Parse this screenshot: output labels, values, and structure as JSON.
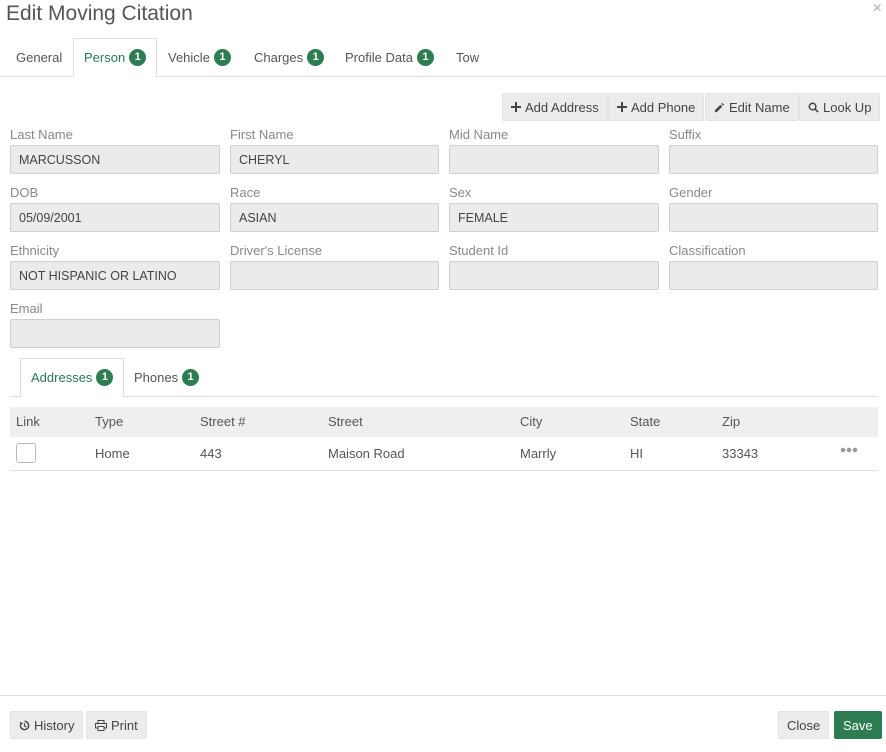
{
  "dialog": {
    "title": "Edit Moving Citation",
    "close_symbol": "×"
  },
  "tabs": [
    {
      "label": "General",
      "badge": ""
    },
    {
      "label": "Person",
      "badge": "1",
      "active": true
    },
    {
      "label": "Vehicle",
      "badge": "1"
    },
    {
      "label": "Charges",
      "badge": "1"
    },
    {
      "label": "Profile Data",
      "badge": "1"
    },
    {
      "label": "Tow",
      "badge": ""
    }
  ],
  "toolbar": {
    "add_address": "Add Address",
    "add_phone": "Add Phone",
    "edit_name": "Edit Name",
    "look_up": "Look Up"
  },
  "fields": {
    "last_name": {
      "label": "Last Name",
      "value": "MARCUSSON"
    },
    "first_name": {
      "label": "First Name",
      "value": "CHERYL"
    },
    "mid_name": {
      "label": "Mid Name",
      "value": ""
    },
    "suffix": {
      "label": "Suffix",
      "value": ""
    },
    "dob": {
      "label": "DOB",
      "value": "05/09/2001"
    },
    "race": {
      "label": "Race",
      "value": "ASIAN"
    },
    "sex": {
      "label": "Sex",
      "value": "FEMALE"
    },
    "gender": {
      "label": "Gender",
      "value": ""
    },
    "ethnicity": {
      "label": "Ethnicity",
      "value": "NOT HISPANIC OR LATINO"
    },
    "drivers_license": {
      "label": "Driver's License",
      "value": ""
    },
    "student_id": {
      "label": "Student Id",
      "value": ""
    },
    "classification": {
      "label": "Classification",
      "value": ""
    },
    "email": {
      "label": "Email",
      "value": ""
    }
  },
  "subtabs": [
    {
      "label": "Addresses",
      "badge": "1",
      "active": true
    },
    {
      "label": "Phones",
      "badge": "1"
    }
  ],
  "address_table": {
    "columns": [
      "Link",
      "Type",
      "Street #",
      "Street",
      "City",
      "State",
      "Zip"
    ],
    "rows": [
      {
        "type": "Home",
        "street_no": "443",
        "street": "Maison Road",
        "city": "Marrly",
        "state": "HI",
        "zip": "33343"
      }
    ]
  },
  "footer": {
    "history": "History",
    "print": "Print",
    "close": "Close",
    "save": "Save"
  },
  "colors": {
    "accent": "#2e7d52",
    "input_bg": "#ebebeb"
  }
}
